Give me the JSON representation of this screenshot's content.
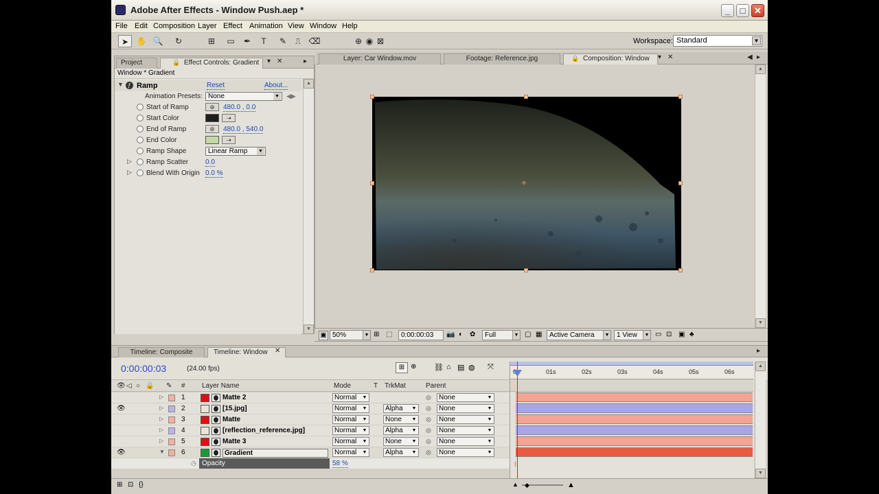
{
  "window": {
    "title": "Adobe After Effects - Window Push.aep *"
  },
  "menu": [
    "File",
    "Edit",
    "Composition",
    "Layer",
    "Effect",
    "Animation",
    "View",
    "Window",
    "Help"
  ],
  "toolbar": {
    "workspace_label": "Workspace:",
    "workspace_value": "Standard"
  },
  "left_panel": {
    "tabs": [
      "Project",
      "Effect Controls: Gradient"
    ],
    "subtitle": "Window * Gradient",
    "effect": {
      "name": "Ramp",
      "reset": "Reset",
      "about": "About..."
    },
    "presets_label": "Animation Presets:",
    "presets_value": "None",
    "props": [
      {
        "label": "Start of Ramp",
        "value": "480.0 , 0.0"
      },
      {
        "label": "Start Color",
        "color": "#1e1e1e"
      },
      {
        "label": "End of Ramp",
        "value": "480.0 , 540.0"
      },
      {
        "label": "End Color",
        "color": "#c4d8a8"
      },
      {
        "label": "Ramp Shape",
        "value": "Linear Ramp"
      },
      {
        "label": "Ramp Scatter",
        "value": "0.0"
      },
      {
        "label": "Blend With Origin",
        "value": "0.0 %"
      }
    ]
  },
  "comp_panel": {
    "tabs": [
      "Layer: Car Window.mov",
      "Footage: Reference.jpg",
      "Composition: Window"
    ],
    "zoom": "50%",
    "timecode": "0:00:00:03",
    "resolution": "Full",
    "camera": "Active Camera",
    "views": "1 View"
  },
  "timeline": {
    "tabs": [
      "Timeline: Composite",
      "Timeline: Window"
    ],
    "current_time": "0:00:00:03",
    "fps": "(24.00 fps)",
    "columns": [
      "#",
      "Layer Name",
      "Mode",
      "T",
      "TrkMat",
      "Parent"
    ],
    "ruler": [
      "01s",
      "02s",
      "03s",
      "04s",
      "05s",
      "06s"
    ],
    "layers": [
      {
        "num": "1",
        "name": "Matte 2",
        "mode": "Normal",
        "trkmat": "",
        "parent": "None",
        "label": "#f4b0a0",
        "src": "#e01010",
        "bar": "#f4a493",
        "eye": ""
      },
      {
        "num": "2",
        "name": "[15.jpg]",
        "mode": "Normal",
        "trkmat": "Alpha",
        "parent": "None",
        "label": "#b8b4e8",
        "src": "#e8e4d8",
        "bar": "#aaa4e8",
        "eye": "👁"
      },
      {
        "num": "3",
        "name": "Matte",
        "mode": "Normal",
        "trkmat": "None",
        "parent": "None",
        "label": "#f4b0a0",
        "src": "#e01010",
        "bar": "#f4a493",
        "eye": ""
      },
      {
        "num": "4",
        "name": "[reflection_reference.jpg]",
        "mode": "Normal",
        "trkmat": "Alpha",
        "parent": "None",
        "label": "#b8b4e8",
        "src": "#e8e4d8",
        "bar": "#aaa4e8",
        "eye": ""
      },
      {
        "num": "5",
        "name": "Matte 3",
        "mode": "Normal",
        "trkmat": "None",
        "parent": "None",
        "label": "#f4b0a0",
        "src": "#e01010",
        "bar": "#f4a493",
        "eye": ""
      },
      {
        "num": "6",
        "name": "Gradient",
        "mode": "Normal",
        "trkmat": "Alpha",
        "parent": "None",
        "label": "#f4b0a0",
        "src": "#10a030",
        "bar": "#ea5a40",
        "eye": "👁"
      }
    ],
    "opacity": {
      "label": "Opacity",
      "value": "58 %"
    }
  }
}
